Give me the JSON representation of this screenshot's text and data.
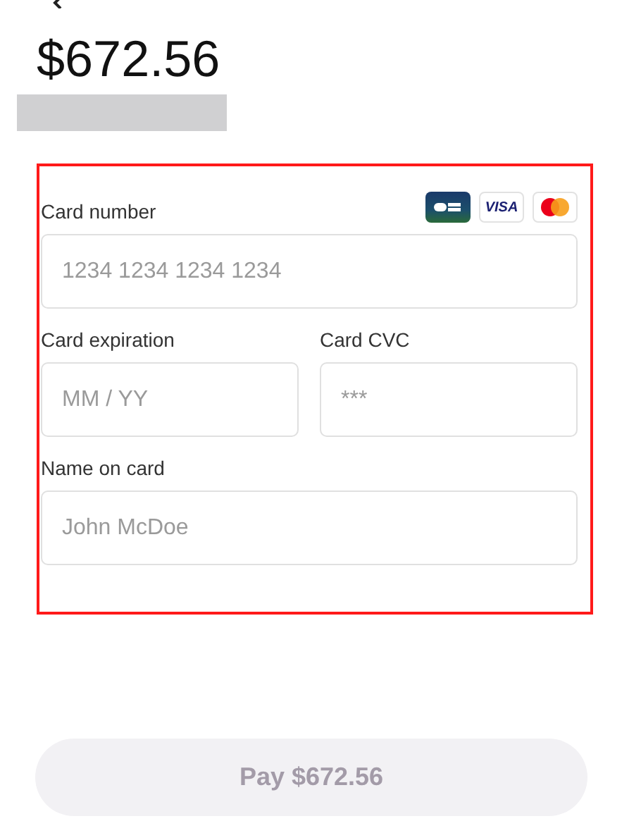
{
  "amount": "$672.56",
  "payment_form": {
    "highlighted": true,
    "card_number": {
      "label": "Card number",
      "placeholder": "1234 1234 1234 1234"
    },
    "card_brands": [
      {
        "kind": "cb"
      },
      {
        "kind": "visa",
        "label": "VISA"
      },
      {
        "kind": "mastercard"
      }
    ],
    "card_expiration": {
      "label": "Card expiration",
      "placeholder": "MM / YY"
    },
    "card_cvc": {
      "label": "Card CVC",
      "placeholder": "***"
    },
    "name_on_card": {
      "label": "Name on card",
      "placeholder": "John McDoe"
    }
  },
  "pay_button": {
    "label": "Pay $672.56",
    "disabled": true
  }
}
